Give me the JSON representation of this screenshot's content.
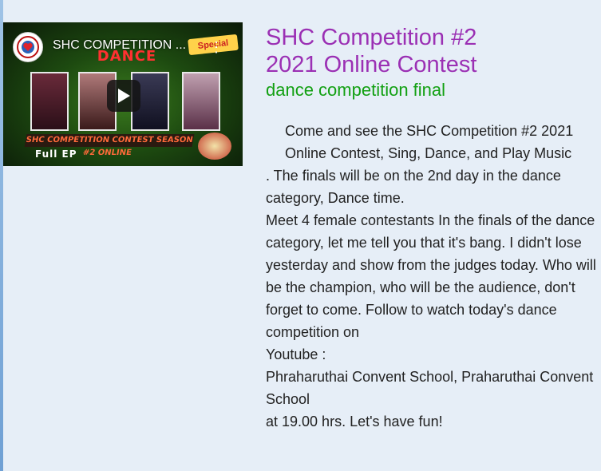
{
  "video": {
    "title": "SHC COMPETITION ...",
    "thumbnail": {
      "heading": "DANCE",
      "season_text": "SHC COMPETITION CONTEST SEASON #2 ONLINE",
      "footer_text": "Full EP",
      "tag_text": "Special"
    },
    "icons": {
      "more": "more-vertical-icon",
      "play": "play-icon",
      "avatar": "school-logo-icon"
    },
    "colors": {
      "play_bg": "#141414",
      "thumb_green": "#3a7a1e"
    }
  },
  "header": {
    "title_line1": "SHC Competition #2",
    "title_line2": "2021 Online Contest",
    "subtitle": "dance competition final",
    "colors": {
      "title": "#9b30b4",
      "subtitle": "#12a012"
    }
  },
  "description": {
    "lines": [
      "Come and see the SHC Competition #2 2021 Online Contest, Sing, Dance, and Play Music",
      ". The finals will be on the 2nd day in the dance category, Dance time.",
      "Meet 4 female contestants In the finals of the dance category, let me tell you that it's bang. I didn't lose yesterday and show from the judges today. Who will be the champion, who will be the audience, don't forget to come. Follow to watch today's dance competition on",
      "Youtube :",
      "Phraharuthai Convent School, Praharuthai Convent School",
      "at 19.00 hrs. Let's have fun!"
    ]
  }
}
